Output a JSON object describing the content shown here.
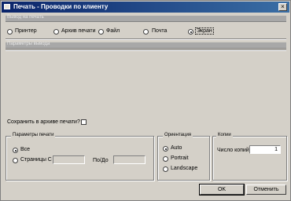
{
  "window": {
    "title": "Печать - Проводки по клиенту",
    "close_glyph": "×"
  },
  "output_section": {
    "header": "Вывод на печать",
    "options": [
      {
        "label": "Принтер",
        "selected": false
      },
      {
        "label": "Архив печати",
        "selected": false
      },
      {
        "label": "Файл",
        "selected": false
      },
      {
        "label": "Почта",
        "selected": false
      },
      {
        "label": "Экран",
        "selected": true
      }
    ]
  },
  "options_section": {
    "header": "Параметры вывода"
  },
  "save_to_archive": {
    "label": "Сохранить в архиве печати?",
    "checked": false
  },
  "print_params": {
    "legend": "Параметры печати",
    "all_label": "Все",
    "pages_label": "Страницы С",
    "to_label": "По/До",
    "from_value": "",
    "to_value": ""
  },
  "orientation": {
    "legend": "Ориентация",
    "options": [
      {
        "label": "Auto",
        "selected": true
      },
      {
        "label": "Portrait",
        "selected": false
      },
      {
        "label": "Landscape",
        "selected": false
      }
    ]
  },
  "copies": {
    "legend": "Копии",
    "label": "Число копий",
    "value": "1"
  },
  "buttons": {
    "ok": "OK",
    "cancel": "Отменить"
  }
}
